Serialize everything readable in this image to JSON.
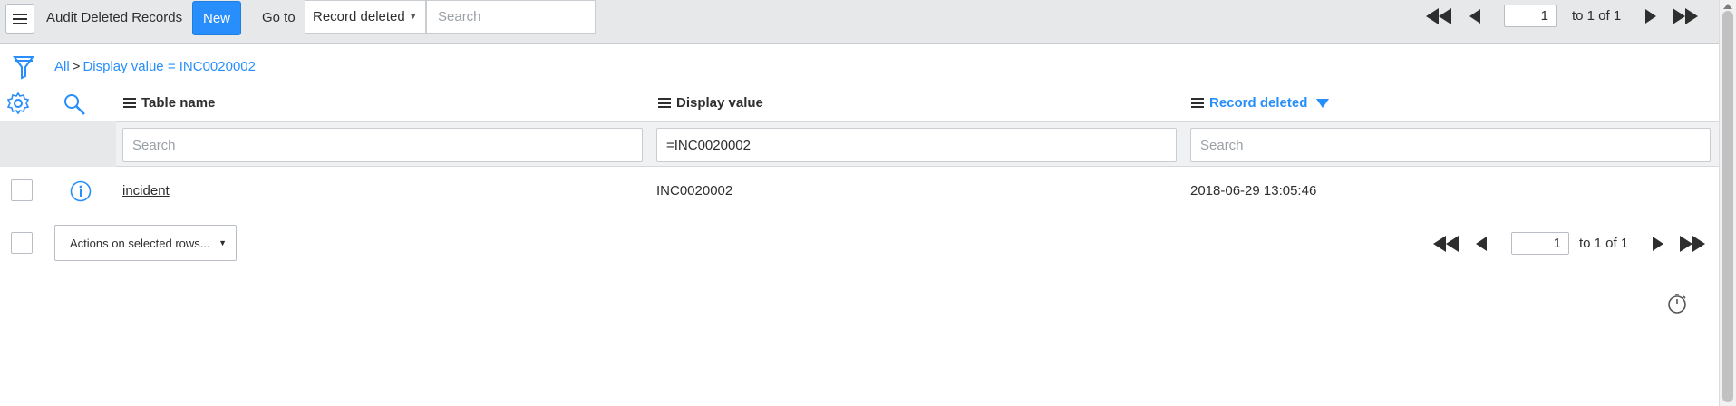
{
  "header": {
    "title": "Audit Deleted Records",
    "new_label": "New",
    "goto_label": "Go to",
    "field_select": "Record deleted",
    "search_placeholder": "Search",
    "page_value": "1",
    "page_of": "to 1 of 1"
  },
  "breadcrumb": {
    "all": "All",
    "separator": ">",
    "filter": "Display value = INC0020002"
  },
  "columns": [
    {
      "label": "Table name",
      "filter_value": "",
      "filter_placeholder": "Search"
    },
    {
      "label": "Display value",
      "filter_value": "=INC0020002",
      "filter_placeholder": "Search"
    },
    {
      "label": "Record deleted",
      "filter_value": "",
      "filter_placeholder": "Search"
    }
  ],
  "rows": [
    {
      "table_name": "incident",
      "display_value": "INC0020002",
      "record_deleted": "2018-06-29 13:05:46"
    }
  ],
  "footer": {
    "actions_label": "Actions on selected rows...",
    "page_value": "1",
    "page_of": "to 1 of 1"
  },
  "colors": {
    "accent": "#278efc",
    "header_bg": "#e6e8ea"
  },
  "icons": [
    "list-menu-icon",
    "filter-funnel-icon",
    "gear-icon",
    "search-icon",
    "info-icon",
    "stopwatch-icon",
    "first-page-icon",
    "previous-page-icon",
    "next-page-icon",
    "last-page-icon",
    "sort-descending-icon"
  ]
}
